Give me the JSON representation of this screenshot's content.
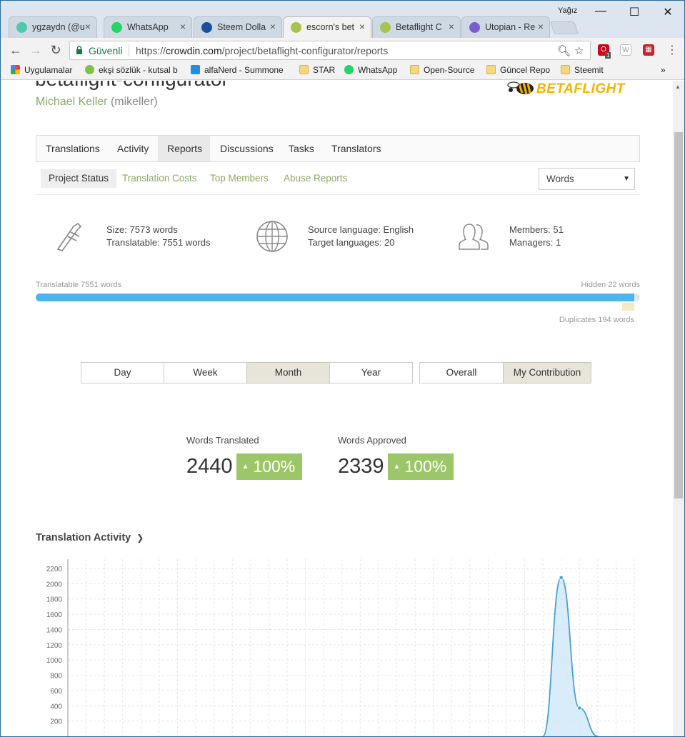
{
  "browser": {
    "user": "Yağız",
    "tabs": [
      {
        "label": "ygzaydn (@u",
        "icon": "steem-icon",
        "color": "#4dc9b0"
      },
      {
        "label": "WhatsApp",
        "icon": "whatsapp-icon",
        "color": "#25d366"
      },
      {
        "label": "Steem Dolla",
        "icon": "steem-icon",
        "color": "#1a5099"
      },
      {
        "label": "escorn's bet",
        "icon": "betaflight-icon",
        "color": "#a6c34b",
        "active": true
      },
      {
        "label": "Betaflight C",
        "icon": "betaflight-icon",
        "color": "#a6c34b"
      },
      {
        "label": "Utopian - Re",
        "icon": "utopian-icon",
        "color": "#7c5ccf"
      }
    ],
    "secure_label": "Güvenli",
    "url_prefix": "https://",
    "url_host": "crowdin.com",
    "url_path": "/project/betaflight-configurator/reports",
    "extension_badge": "1",
    "bookmarks": [
      {
        "label": "Uygulamalar",
        "icon": "apps-icon"
      },
      {
        "label": "ekşi sözlük - kutsal b",
        "icon": "eksi-icon"
      },
      {
        "label": "alfaNerd - Summone",
        "icon": "alfanerd-icon"
      },
      {
        "label": "STAR",
        "icon": "folder-icon"
      },
      {
        "label": "WhatsApp",
        "icon": "whatsapp-icon"
      },
      {
        "label": "Open-Source",
        "icon": "folder-icon"
      },
      {
        "label": "Güncel Repo",
        "icon": "folder-icon"
      },
      {
        "label": "Steemit",
        "icon": "folder-icon"
      }
    ]
  },
  "project": {
    "title": "betaflight-configurator",
    "owner_name": "Michael Keller",
    "owner_handle": "(mikeller)",
    "logo_text": "BETAFLIGHT"
  },
  "main_tabs": [
    "Translations",
    "Activity",
    "Reports",
    "Discussions",
    "Tasks",
    "Translators"
  ],
  "active_main_tab": "Reports",
  "sub_tabs": [
    "Project Status",
    "Translation Costs",
    "Top Members",
    "Abuse Reports"
  ],
  "unit_select": "Words",
  "stats": {
    "size": "Size: 7573 words",
    "translatable": "Translatable: 7551 words",
    "source_language": "Source language: English",
    "target_languages": "Target languages: 20",
    "members": "Members: 51",
    "managers": "Managers: 1"
  },
  "progress": {
    "left_label": "Translatable 7551 words",
    "right_label": "Hidden 22 words",
    "duplicates_label": "Duplicates 194 words",
    "translatable_fraction": 0.991
  },
  "period_buttons": [
    "Day",
    "Week",
    "Month",
    "Year"
  ],
  "active_period": "Month",
  "scope_buttons": [
    "Overall",
    "My Contribution"
  ],
  "active_scope": "My Contribution",
  "metrics": {
    "translated_label": "Words Translated",
    "translated_value": "2440",
    "translated_change": "100%",
    "approved_label": "Words Approved",
    "approved_value": "2339",
    "approved_change": "100%"
  },
  "activity_heading": "Translation Activity",
  "colors": {
    "accent_green": "#8aaa64",
    "badge_green": "#9cc769",
    "progress_blue": "#4db4ee",
    "chart_line": "#4a9fd8",
    "chart_fill": "#cfe7f8"
  },
  "chart_data": {
    "type": "area",
    "y_ticks": [
      200,
      400,
      600,
      800,
      1000,
      1200,
      1400,
      1600,
      1800,
      2000,
      2200
    ],
    "ylim": [
      0,
      2250
    ],
    "x_count": 32,
    "points": [
      {
        "x": 26,
        "y": 0
      },
      {
        "x": 27,
        "y": 2080
      },
      {
        "x": 28,
        "y": 370
      },
      {
        "x": 29,
        "y": 0
      }
    ],
    "grid": true,
    "title": "",
    "xlabel": "",
    "ylabel": ""
  }
}
